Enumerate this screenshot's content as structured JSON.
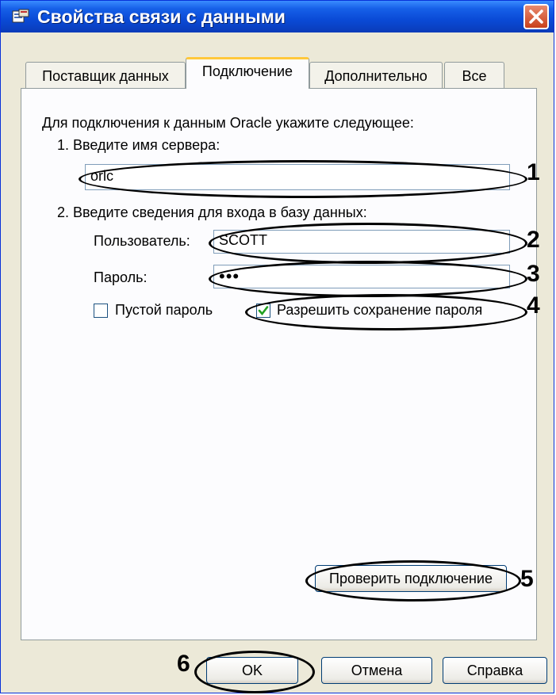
{
  "window": {
    "title": "Свойства связи с данными",
    "icons": {
      "app": "data-link-icon",
      "close": "close-icon"
    }
  },
  "tabs": [
    {
      "label": "Поставщик данных"
    },
    {
      "label": "Подключение"
    },
    {
      "label": "Дополнительно"
    },
    {
      "label": "Все"
    }
  ],
  "connection": {
    "intro": "Для подключения к данным Oracle укажите следующее:",
    "step1": "1. Введите имя сервера:",
    "server_value": "orlc",
    "step2": "2. Введите сведения для входа в базу данных:",
    "user_label": "Пользователь:",
    "user_value": "SCOTT",
    "password_label": "Пароль:",
    "password_value": "•••",
    "blank_password_label": "Пустой пароль",
    "blank_password_checked": false,
    "allow_save_label": "Разрешить сохранение пароля",
    "allow_save_checked": true,
    "test_button": "Проверить подключение"
  },
  "footer": {
    "ok": "OK",
    "cancel": "Отмена",
    "help": "Справка"
  },
  "callouts": [
    "1",
    "2",
    "3",
    "4",
    "5",
    "6"
  ],
  "colors": {
    "titlebar": "#0A4AD6",
    "dialog_bg": "#ECE9D8",
    "tab_highlight": "#FFC83C",
    "checkmark": "#21A121"
  }
}
